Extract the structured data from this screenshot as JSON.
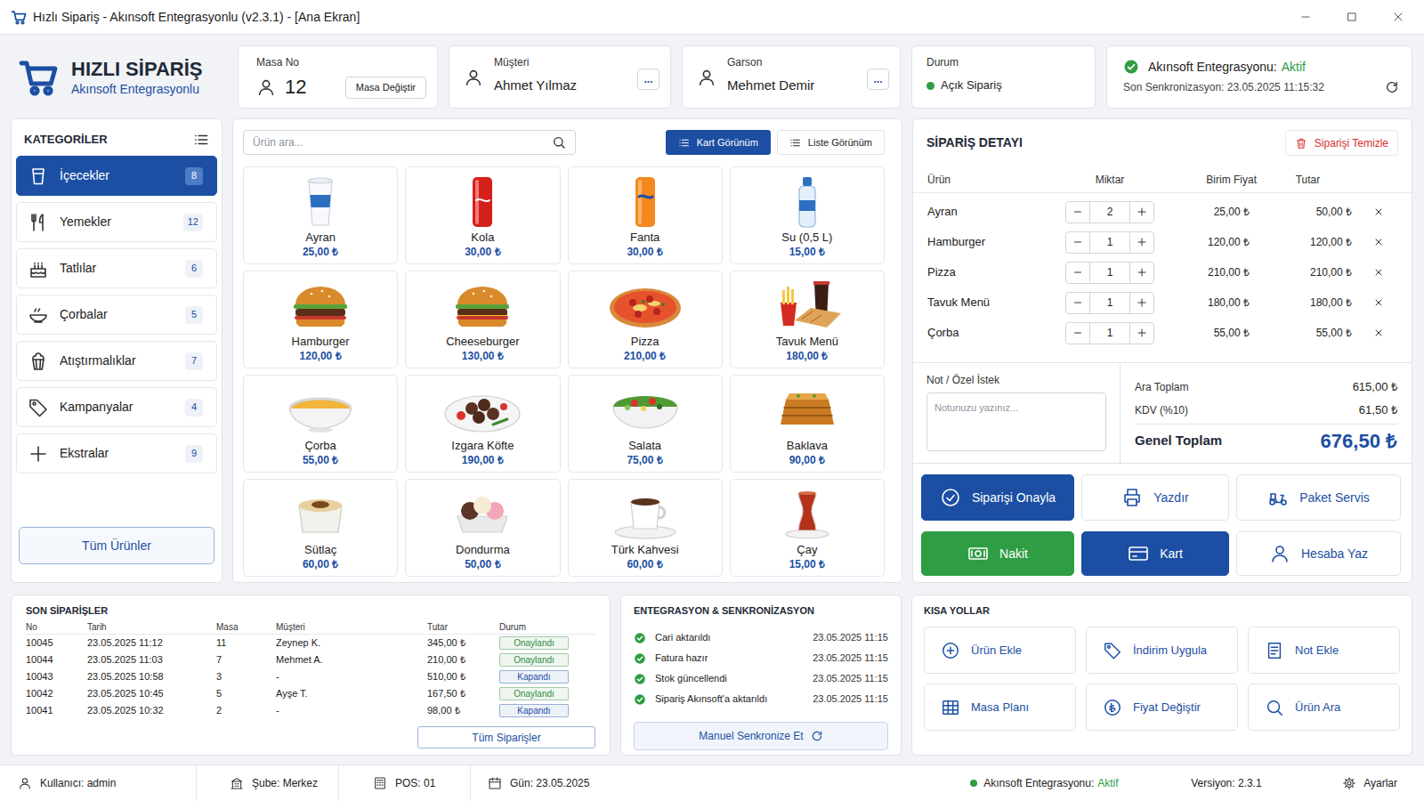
{
  "window": {
    "title": "Hızlı Sipariş - Akınsoft Entegrasyonlu (v2.3.1) - [Ana Ekran]"
  },
  "header": {
    "logo": {
      "title": "HIZLI SİPARİŞ",
      "subtitle": "Akınsoft Entegrasyonlu"
    },
    "table": {
      "label": "Masa No",
      "value": "12",
      "button": "Masa Değiştir"
    },
    "customer": {
      "label": "Müşteri",
      "value": "Ahmet Yılmaz",
      "button": "..."
    },
    "waiter": {
      "label": "Garson",
      "value": "Mehmet Demir",
      "button": "..."
    },
    "status": {
      "label": "Durum",
      "value": "Açık Sipariş"
    },
    "integration": {
      "label": "Akınsoft Entegrasyonu:",
      "value": "Aktif",
      "last_sync": "Son Senkronizasyon: 23.05.2025 11:15:32"
    }
  },
  "categories": {
    "title": "KATEGORİLER",
    "items": [
      {
        "label": "İçecekler",
        "count": "8",
        "selected": true
      },
      {
        "label": "Yemekler",
        "count": "12",
        "selected": false
      },
      {
        "label": "Tatlılar",
        "count": "6",
        "selected": false
      },
      {
        "label": "Çorbalar",
        "count": "5",
        "selected": false
      },
      {
        "label": "Atıştırmalıklar",
        "count": "7",
        "selected": false
      },
      {
        "label": "Kampanyalar",
        "count": "4",
        "selected": false
      },
      {
        "label": "Ekstralar",
        "count": "9",
        "selected": false
      }
    ],
    "all_button": "Tüm Ürünler"
  },
  "products": {
    "search": {
      "placeholder": "Ürün ara..."
    },
    "views": [
      {
        "label": "Kart Görünüm",
        "selected": true
      },
      {
        "label": "Liste Görünüm",
        "selected": false
      }
    ],
    "items": [
      {
        "name": "Ayran",
        "price": "25,00 ₺"
      },
      {
        "name": "Kola",
        "price": "30,00 ₺"
      },
      {
        "name": "Fanta",
        "price": "30,00 ₺"
      },
      {
        "name": "Su (0,5 L)",
        "price": "15,00 ₺"
      },
      {
        "name": "Hamburger",
        "price": "120,00 ₺"
      },
      {
        "name": "Cheeseburger",
        "price": "130,00 ₺"
      },
      {
        "name": "Pizza",
        "price": "210,00 ₺"
      },
      {
        "name": "Tavuk Menü",
        "price": "180,00 ₺"
      },
      {
        "name": "Çorba",
        "price": "55,00 ₺"
      },
      {
        "name": "Izgara Köfte",
        "price": "190,00 ₺"
      },
      {
        "name": "Salata",
        "price": "75,00 ₺"
      },
      {
        "name": "Baklava",
        "price": "90,00 ₺"
      },
      {
        "name": "Sütlaç",
        "price": "60,00 ₺"
      },
      {
        "name": "Dondurma",
        "price": "50,00 ₺"
      },
      {
        "name": "Türk Kahvesi",
        "price": "60,00 ₺"
      },
      {
        "name": "Çay",
        "price": "15,00 ₺"
      }
    ]
  },
  "order": {
    "title": "SİPARİŞ DETAYI",
    "clear_button": "Siparişi Temizle",
    "columns": [
      "Ürün",
      "Miktar",
      "Birim Fiyat",
      "Tutar"
    ],
    "rows": [
      {
        "product": "Ayran",
        "qty": "2",
        "unit_price": "25,00 ₺",
        "total": "50,00 ₺"
      },
      {
        "product": "Hamburger",
        "qty": "1",
        "unit_price": "120,00 ₺",
        "total": "120,00 ₺"
      },
      {
        "product": "Pizza",
        "qty": "1",
        "unit_price": "210,00 ₺",
        "total": "210,00 ₺"
      },
      {
        "product": "Tavuk Menü",
        "qty": "1",
        "unit_price": "180,00 ₺",
        "total": "180,00 ₺"
      },
      {
        "product": "Çorba",
        "qty": "1",
        "unit_price": "55,00 ₺",
        "total": "55,00 ₺"
      }
    ],
    "note": {
      "label": "Not / Özel İstek",
      "placeholder": "Notunuzu yazınız..."
    },
    "totals": [
      {
        "label": "Ara Toplam",
        "value": "615,00 ₺"
      },
      {
        "label": "KDV (%10)",
        "value": "61,50 ₺"
      }
    ],
    "grand_total": {
      "label": "Genel Toplam",
      "value": "676,50 ₺"
    }
  },
  "actions": [
    {
      "label": "Siparişi Onayla",
      "kind": "primary"
    },
    {
      "label": "Yazdır",
      "kind": "outline"
    },
    {
      "label": "Paket Servis",
      "kind": "outline"
    },
    {
      "label": "Nakit",
      "kind": "success"
    },
    {
      "label": "Kart",
      "kind": "primary"
    },
    {
      "label": "Hesaba Yaz",
      "kind": "outline"
    }
  ],
  "recent_orders": {
    "title": "SON SİPARİŞLER",
    "columns": [
      "No",
      "Tarih",
      "Masa",
      "Müşteri",
      "Tutar",
      "Durum"
    ],
    "rows": [
      {
        "cells": [
          "10045",
          "23.05.2025 11:12",
          "11",
          "Zeynep K.",
          "345,00 ₺"
        ],
        "status": "Onaylandı",
        "color": "#2e8b3e"
      },
      {
        "cells": [
          "10044",
          "23.05.2025 11:03",
          "7",
          "Mehmet A.",
          "210,00 ₺"
        ],
        "status": "Onaylandı",
        "color": "#2e8b3e"
      },
      {
        "cells": [
          "10043",
          "23.05.2025 10:58",
          "3",
          "-",
          "510,00 ₺"
        ],
        "status": "Kapandı",
        "color": "#1c4fa3"
      },
      {
        "cells": [
          "10042",
          "23.05.2025 10:45",
          "5",
          "Ayşe T.",
          "167,50 ₺"
        ],
        "status": "Onaylandı",
        "color": "#2e8b3e"
      },
      {
        "cells": [
          "10041",
          "23.05.2025 10:32",
          "2",
          "-",
          "98,00 ₺"
        ],
        "status": "Kapandı",
        "color": "#1c4fa3"
      }
    ],
    "button": "Tüm Siparişler"
  },
  "integration": {
    "title": "ENTEGRASYON & SENKRONİZASYON",
    "items": [
      {
        "label": "Cari aktarıldı",
        "time": "23.05.2025 11:15",
        "done": true
      },
      {
        "label": "Fatura hazır",
        "time": "23.05.2025 11:15",
        "done": true
      },
      {
        "label": "Stok güncellendi",
        "time": "23.05.2025 11:15",
        "done": true
      },
      {
        "label": "Sipariş Akınsoft'a aktarıldı",
        "time": "23.05.2025 11:15",
        "done": true
      }
    ],
    "button": "Manuel Senkronize Et"
  },
  "shortcuts": {
    "title": "KISA YOLLAR",
    "items": [
      "Ürün Ekle",
      "İndirim Uygula",
      "Not Ekle",
      "Masa Planı",
      "Fiyat Değiştir",
      "Ürün Ara"
    ]
  },
  "status_bar": {
    "user": "Kullanıcı: admin",
    "branch": "Şube: Merkez",
    "pos": "POS: 01",
    "day": "Gün: 23.05.2025",
    "integration_label": "Akınsoft Entegrasyonu:",
    "integration_value": "Aktif",
    "version": "Versiyon: 2.3.1",
    "settings": "Ayarlar"
  }
}
